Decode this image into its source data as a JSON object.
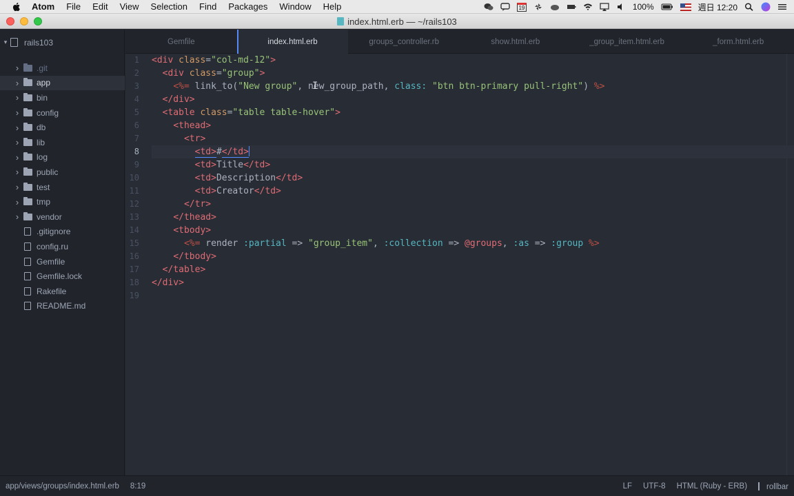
{
  "menubar": {
    "items": [
      "Atom",
      "File",
      "Edit",
      "View",
      "Selection",
      "Find",
      "Packages",
      "Window",
      "Help"
    ],
    "battery": "100%",
    "clock": "週日 12:20",
    "calendar_day": "19"
  },
  "window": {
    "title": "index.html.erb — ~/rails103"
  },
  "tree": {
    "root": "rails103",
    "items": [
      {
        "label": ".git",
        "kind": "folder",
        "ignored": true
      },
      {
        "label": "app",
        "kind": "folder",
        "selected": true
      },
      {
        "label": "bin",
        "kind": "folder"
      },
      {
        "label": "config",
        "kind": "folder"
      },
      {
        "label": "db",
        "kind": "folder"
      },
      {
        "label": "lib",
        "kind": "folder"
      },
      {
        "label": "log",
        "kind": "folder"
      },
      {
        "label": "public",
        "kind": "folder"
      },
      {
        "label": "test",
        "kind": "folder"
      },
      {
        "label": "tmp",
        "kind": "folder"
      },
      {
        "label": "vendor",
        "kind": "folder"
      },
      {
        "label": ".gitignore",
        "kind": "file"
      },
      {
        "label": "config.ru",
        "kind": "file"
      },
      {
        "label": "Gemfile",
        "kind": "file"
      },
      {
        "label": "Gemfile.lock",
        "kind": "file"
      },
      {
        "label": "Rakefile",
        "kind": "file"
      },
      {
        "label": "README.md",
        "kind": "file"
      }
    ]
  },
  "tabs": [
    {
      "label": "Gemfile",
      "active": false
    },
    {
      "label": "index.html.erb",
      "active": true
    },
    {
      "label": "groups_controller.rb",
      "active": false
    },
    {
      "label": "show.html.erb",
      "active": false
    },
    {
      "label": "_group_item.html.erb",
      "active": false
    },
    {
      "label": "_form.html.erb",
      "active": false
    }
  ],
  "editor": {
    "current_line": 8,
    "line_numbers": [
      "1",
      "2",
      "3",
      "4",
      "5",
      "6",
      "7",
      "8",
      "9",
      "10",
      "11",
      "12",
      "13",
      "14",
      "15",
      "16",
      "17",
      "18",
      "19"
    ],
    "lines": [
      [
        [
          "tag",
          "<div "
        ],
        [
          "attr",
          "class"
        ],
        [
          "op",
          "="
        ],
        [
          "str",
          "\"col-md-12\""
        ],
        [
          "tag",
          ">"
        ]
      ],
      [
        [
          "text",
          "  "
        ],
        [
          "tag",
          "<div "
        ],
        [
          "attr",
          "class"
        ],
        [
          "op",
          "="
        ],
        [
          "str",
          "\"group\""
        ],
        [
          "tag",
          ">"
        ]
      ],
      [
        [
          "text",
          "    "
        ],
        [
          "erb",
          "<%="
        ],
        [
          "text",
          " link_to("
        ],
        [
          "str",
          "\"New group\""
        ],
        [
          "text",
          ", new_group_path, "
        ],
        [
          "key",
          "class:"
        ],
        [
          "text",
          " "
        ],
        [
          "str",
          "\"btn btn-primary pull-right\""
        ],
        [
          "text",
          ") "
        ],
        [
          "erb",
          "%>"
        ]
      ],
      [
        [
          "text",
          "  "
        ],
        [
          "tag",
          "</div>"
        ]
      ],
      [
        [
          "text",
          "  "
        ],
        [
          "tag",
          "<table "
        ],
        [
          "attr",
          "class"
        ],
        [
          "op",
          "="
        ],
        [
          "str",
          "\"table table-hover\""
        ],
        [
          "tag",
          ">"
        ]
      ],
      [
        [
          "text",
          "    "
        ],
        [
          "tag",
          "<thead>"
        ]
      ],
      [
        [
          "text",
          "      "
        ],
        [
          "tag",
          "<tr>"
        ]
      ],
      [
        [
          "text",
          "        "
        ],
        [
          "tag",
          "<td>"
        ],
        [
          "text",
          "#"
        ],
        [
          "tag",
          "</td>"
        ]
      ],
      [
        [
          "text",
          "        "
        ],
        [
          "tag",
          "<td>"
        ],
        [
          "text",
          "Title"
        ],
        [
          "tag",
          "</td>"
        ]
      ],
      [
        [
          "text",
          "        "
        ],
        [
          "tag",
          "<td>"
        ],
        [
          "text",
          "Description"
        ],
        [
          "tag",
          "</td>"
        ]
      ],
      [
        [
          "text",
          "        "
        ],
        [
          "tag",
          "<td>"
        ],
        [
          "text",
          "Creator"
        ],
        [
          "tag",
          "</td>"
        ]
      ],
      [
        [
          "text",
          "      "
        ],
        [
          "tag",
          "</tr>"
        ]
      ],
      [
        [
          "text",
          "    "
        ],
        [
          "tag",
          "</thead>"
        ]
      ],
      [
        [
          "text",
          "    "
        ],
        [
          "tag",
          "<tbody>"
        ]
      ],
      [
        [
          "text",
          "      "
        ],
        [
          "erb",
          "<%="
        ],
        [
          "text",
          " render "
        ],
        [
          "sym",
          ":partial"
        ],
        [
          "text",
          " => "
        ],
        [
          "str",
          "\"group_item\""
        ],
        [
          "text",
          ", "
        ],
        [
          "sym",
          ":collection"
        ],
        [
          "text",
          " => "
        ],
        [
          "ivar",
          "@groups"
        ],
        [
          "text",
          ", "
        ],
        [
          "sym",
          ":as"
        ],
        [
          "text",
          " => "
        ],
        [
          "sym",
          ":group"
        ],
        [
          "text",
          " "
        ],
        [
          "erb",
          "%>"
        ]
      ],
      [
        [
          "text",
          "    "
        ],
        [
          "tag",
          "</tbody>"
        ]
      ],
      [
        [
          "text",
          "  "
        ],
        [
          "tag",
          "</table>"
        ]
      ],
      [
        [
          "tag",
          "</div>"
        ]
      ],
      []
    ]
  },
  "status": {
    "path": "app/views/groups/index.html.erb",
    "cursor": "8:19",
    "line_ending": "LF",
    "encoding": "UTF-8",
    "grammar": "HTML (Ruby - ERB)",
    "branch": "rollbar"
  },
  "colors": {
    "editor_bg": "#282c34",
    "panel_bg": "#21252b",
    "accent": "#568af2"
  }
}
